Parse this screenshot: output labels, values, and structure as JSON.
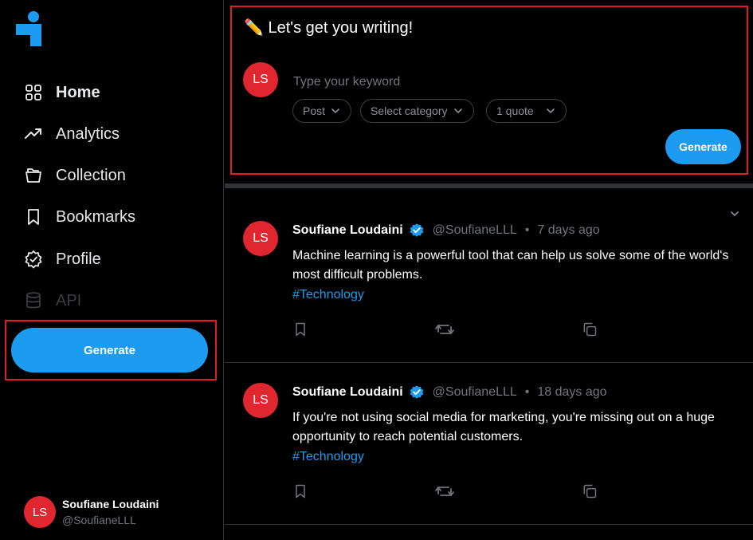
{
  "colors": {
    "accent": "#1d9bf0",
    "avatar": "#e0262f",
    "highlight": "#e01d26",
    "background": "#000000"
  },
  "sidebar": {
    "logo_icon": "app-logo-icon",
    "items": [
      {
        "label": "Home",
        "icon": "grid-icon",
        "active": true
      },
      {
        "label": "Analytics",
        "icon": "trending-up-icon"
      },
      {
        "label": "Collection",
        "icon": "folder-icon"
      },
      {
        "label": "Bookmarks",
        "icon": "bookmark-icon"
      },
      {
        "label": "Profile",
        "icon": "badge-check-icon"
      },
      {
        "label": "API",
        "icon": "database-icon",
        "disabled": true
      }
    ],
    "generate_label": "Generate",
    "user": {
      "initials": "LS",
      "display_name": "Soufiane Loudaini",
      "handle": "@SoufianeLLL"
    }
  },
  "composer": {
    "title": "✏️ Let's get you writing!",
    "avatar_initials": "LS",
    "keyword_placeholder": "Type your keyword",
    "keyword_value": "",
    "type_select": "Post",
    "category_select": "Select category",
    "quote_select": "1 quote",
    "generate_label": "Generate"
  },
  "posts": [
    {
      "initials": "LS",
      "display_name": "Soufiane Loudaini",
      "handle": "@SoufianeLLL",
      "separator": "•",
      "time": "7 days ago",
      "text": "Machine learning is a powerful tool that can help us solve some of the world's most difficult problems.",
      "tag": "#Technology"
    },
    {
      "initials": "LS",
      "display_name": "Soufiane Loudaini",
      "handle": "@SoufianeLLL",
      "separator": "•",
      "time": "18 days ago",
      "text": "If you're not using social media for marketing, you're missing out on a huge opportunity to reach potential customers.",
      "tag": "#Technology"
    }
  ]
}
